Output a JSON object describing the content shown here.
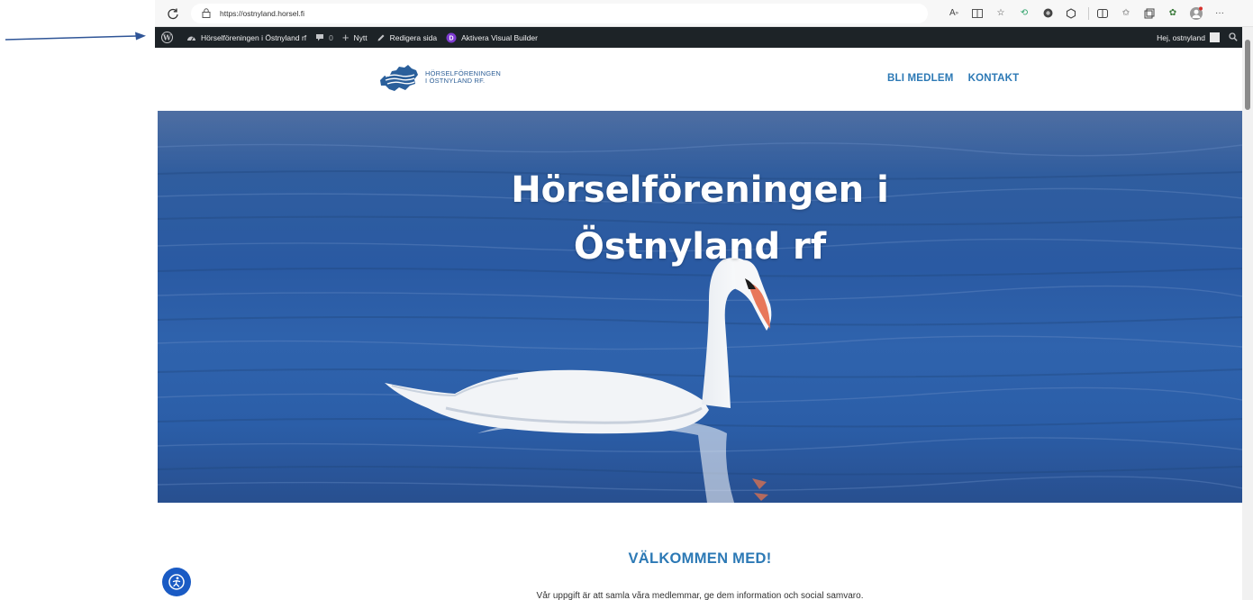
{
  "browser": {
    "url": "https://ostnyland.horsel.fi",
    "icons": [
      "reload-icon",
      "lock-icon",
      "read-aloud-icon",
      "immersive-reader-icon",
      "favorite-star-icon",
      "extension-icon",
      "extension-icon",
      "extension-icon",
      "split-screen-icon",
      "favorites-icon",
      "collections-icon",
      "extension-icon",
      "profile-icon",
      "more-icon"
    ]
  },
  "admin_bar": {
    "site_name": "Hörselföreningen i Östnyland rf",
    "comments_count": "0",
    "new_label": "Nytt",
    "edit_label": "Redigera sida",
    "builder_label": "Aktivera Visual Builder",
    "greeting": "Hej, ostnyland"
  },
  "header": {
    "logo_line1": "HÖRSELFÖRENINGEN",
    "logo_line2": "I ÖSTNYLAND RF.",
    "nav": [
      "BLI MEDLEM",
      "KONTAKT"
    ]
  },
  "hero": {
    "title_line1": "Hörselföreningen i",
    "title_line2": "Östnyland rf"
  },
  "content": {
    "welcome_heading": "VÄLKOMMEN MED!",
    "intro_text": "Vår uppgift är att samla våra medlemmar, ge dem information och social samvaro."
  },
  "colors": {
    "accent": "#2c79b5",
    "admin_bar": "#1d2327",
    "hero_water": "#2f5d9f",
    "accessibility_button": "#1a5bc4"
  }
}
